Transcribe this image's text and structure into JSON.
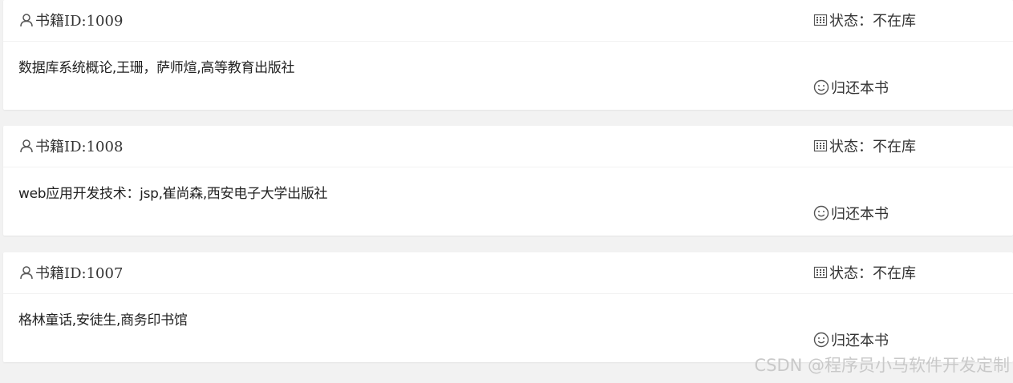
{
  "books": [
    {
      "id_label": "书籍ID:1009",
      "status_label": "状态：",
      "status_value": "不在库",
      "info": "数据库系统概论,王珊，萨师煊,高等教育出版社",
      "return_label": "归还本书"
    },
    {
      "id_label": "书籍ID:1008",
      "status_label": "状态：",
      "status_value": "不在库",
      "info": "web应用开发技术：jsp,崔尚森,西安电子大学出版社",
      "return_label": "归还本书"
    },
    {
      "id_label": "书籍ID:1007",
      "status_label": "状态：",
      "status_value": "不在库",
      "info": "格林童话,安徒生,商务印书馆",
      "return_label": "归还本书"
    }
  ],
  "icons": {
    "book_id": "user-icon",
    "status": "grid-icon",
    "return": "smiley-icon"
  },
  "watermark": "CSDN @程序员小马软件开发定制",
  "colors": {
    "page_background": "#f2f2f2",
    "card_background": "#ffffff",
    "text": "#333333",
    "watermark": "#c9c9c9"
  }
}
